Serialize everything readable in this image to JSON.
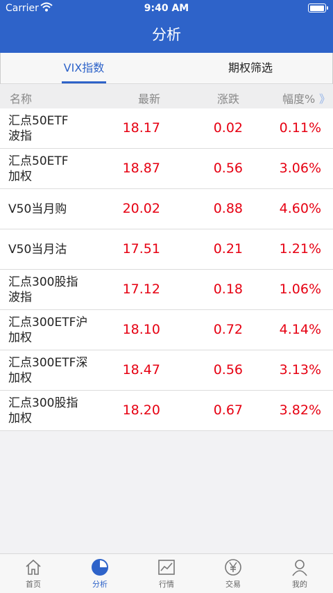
{
  "status": {
    "carrier": "Carrier",
    "time": "9:40 AM"
  },
  "header": {
    "title": "分析"
  },
  "tabs": [
    {
      "label": "VIX指数",
      "active": true
    },
    {
      "label": "期权筛选",
      "active": false
    }
  ],
  "columns": {
    "name": "名称",
    "latest": "最新",
    "change": "涨跌",
    "range": "幅度%",
    "more_glyph": "》"
  },
  "rows": [
    {
      "name": "汇点50ETF\n波指",
      "latest": "18.17",
      "change": "0.02",
      "range": "0.11%"
    },
    {
      "name": "汇点50ETF\n加权",
      "latest": "18.87",
      "change": "0.56",
      "range": "3.06%"
    },
    {
      "name": "V50当月购",
      "latest": "20.02",
      "change": "0.88",
      "range": "4.60%"
    },
    {
      "name": "V50当月沽",
      "latest": "17.51",
      "change": "0.21",
      "range": "1.21%"
    },
    {
      "name": "汇点300股指\n波指",
      "latest": "17.12",
      "change": "0.18",
      "range": "1.06%"
    },
    {
      "name": "汇点300ETF沪\n加权",
      "latest": "18.10",
      "change": "0.72",
      "range": "4.14%"
    },
    {
      "name": "汇点300ETF深\n加权",
      "latest": "18.47",
      "change": "0.56",
      "range": "3.13%"
    },
    {
      "name": "汇点300股指\n加权",
      "latest": "18.20",
      "change": "0.67",
      "range": "3.82%"
    }
  ],
  "nav": [
    {
      "label": "首页",
      "icon": "home-icon"
    },
    {
      "label": "分析",
      "icon": "pie-chart-icon",
      "active": true
    },
    {
      "label": "行情",
      "icon": "line-chart-icon"
    },
    {
      "label": "交易",
      "icon": "yen-icon"
    },
    {
      "label": "我的",
      "icon": "user-icon"
    }
  ],
  "colors": {
    "brand": "#2e63c9",
    "up": "#e60012"
  }
}
